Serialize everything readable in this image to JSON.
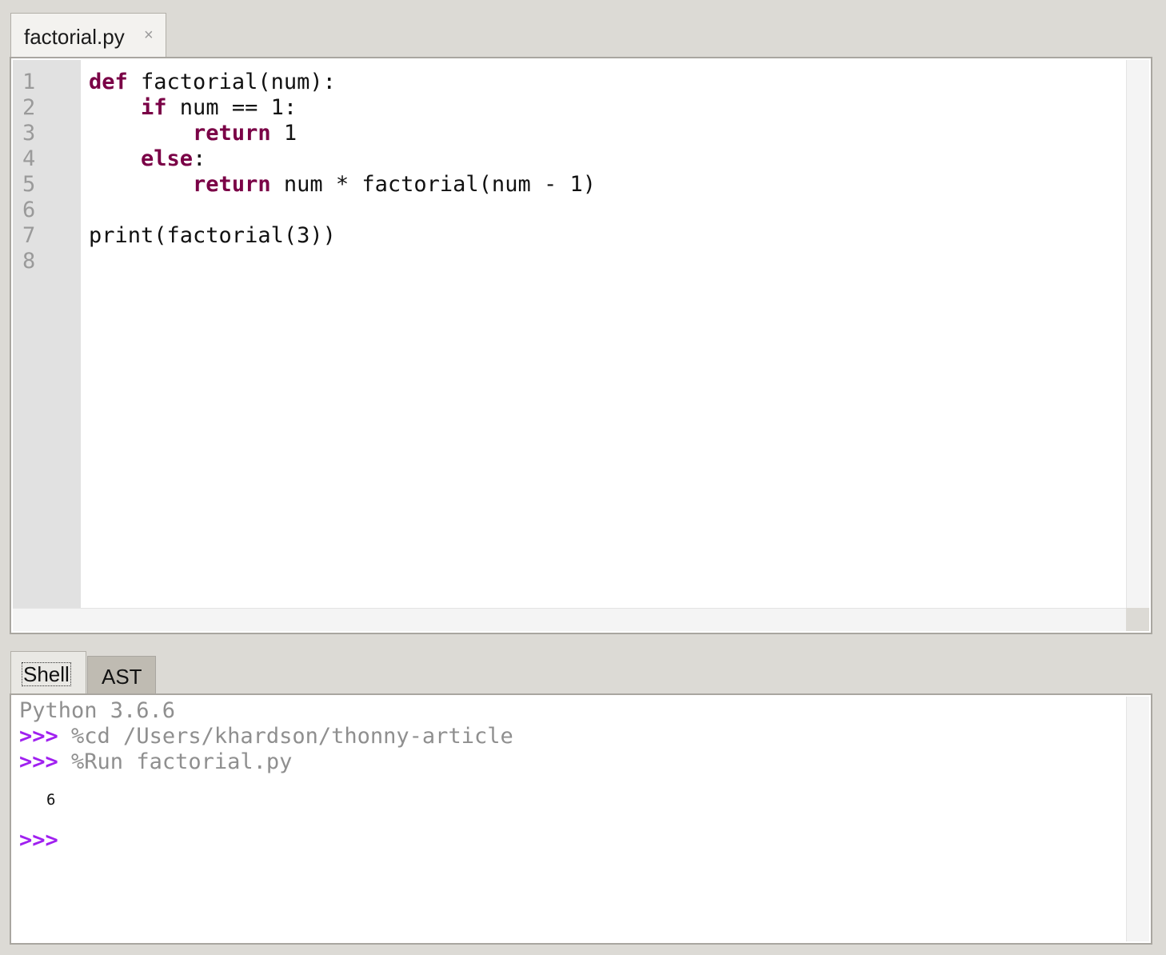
{
  "editor": {
    "tab_label": "factorial.py",
    "close_glyph": "×",
    "line_numbers": [
      "1",
      "2",
      "3",
      "4",
      "5",
      "6",
      "7",
      "8"
    ],
    "code_tokens": {
      "l1_kw": "def",
      "l1_rest": " factorial(num):",
      "l2_indent": "    ",
      "l2_kw": "if",
      "l2_rest": " num == 1:",
      "l3_indent": "        ",
      "l3_kw": "return",
      "l3_rest": " 1",
      "l4_indent": "    ",
      "l4_kw": "else",
      "l4_rest": ":",
      "l5_indent": "        ",
      "l5_kw": "return",
      "l5_rest": " num * factorial(num - 1)",
      "l7": "print(factorial(3))"
    }
  },
  "bottom_tabs": {
    "shell_label": "Shell",
    "ast_label": "AST"
  },
  "shell": {
    "version_line": "Python 3.6.6",
    "prompt": ">>>",
    "cmd1": " %cd /Users/khardson/thonny-article",
    "cmd2": " %Run factorial.py",
    "output": "6"
  },
  "colors": {
    "keyword": "#7a0046",
    "prompt": "#a020f0",
    "muted_text": "#8f8f8f",
    "window_bg": "#dcdad5"
  }
}
